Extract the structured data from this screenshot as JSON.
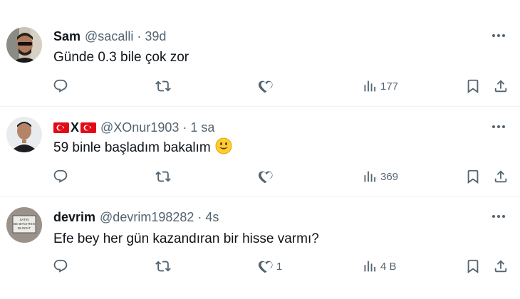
{
  "colors": {
    "text": "#0f1419",
    "muted": "#536471",
    "divider": "#eff3f4",
    "flag_red": "#e30a17"
  },
  "tweets": [
    {
      "display_name": "Sam",
      "handle": "@sacalli",
      "separator": "·",
      "time": "39d",
      "text": "Günde 0.3 bile çok zor",
      "views": "177",
      "likes": ""
    },
    {
      "display_name_sep": "X",
      "handle": "@XOnur1903",
      "separator": "·",
      "time": "1 sa",
      "text": "59 binle başladım bakalım",
      "emoji": "smiling-face-emoji",
      "views": "369",
      "likes": ""
    },
    {
      "display_name": "devrim",
      "handle": "@devrim198282",
      "separator": "·",
      "time": "4s",
      "text": "Efe bey her gün kazandıran bir hisse varmı?",
      "views": "4 B",
      "likes": "1",
      "avatar_sign_text": "SATIN\nBE BITCHTEN\nBLOCKT"
    }
  ],
  "icons": [
    "reply-icon",
    "retweet-icon",
    "like-icon",
    "views-icon",
    "bookmark-icon",
    "share-icon",
    "more-icon"
  ]
}
